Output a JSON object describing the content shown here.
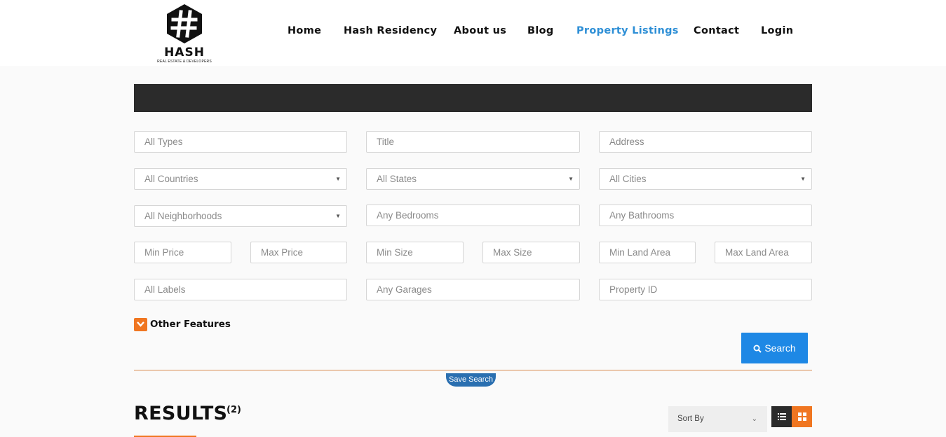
{
  "logo": {
    "word": "HASH",
    "tagline": "REAL ESTATE & DEVELOPERS",
    "icon": "hash-hexagon-logo"
  },
  "nav": {
    "items": [
      {
        "label": "Home"
      },
      {
        "label": "Hash Residency"
      },
      {
        "label": "About us"
      },
      {
        "label": "Blog"
      },
      {
        "label": "Property Listings",
        "active": true
      },
      {
        "label": "Contact"
      },
      {
        "label": "Login"
      }
    ]
  },
  "search_form": {
    "type": {
      "placeholder": "All Types"
    },
    "title": {
      "placeholder": "Title"
    },
    "address": {
      "placeholder": "Address"
    },
    "country": {
      "value": "All Countries"
    },
    "state": {
      "value": "All States"
    },
    "city": {
      "value": "All Cities"
    },
    "neighborhood": {
      "value": "All Neighborhoods"
    },
    "bedrooms": {
      "placeholder": "Any Bedrooms"
    },
    "bathrooms": {
      "placeholder": "Any Bathrooms"
    },
    "min_price": {
      "placeholder": "Min Price"
    },
    "max_price": {
      "placeholder": "Max Price"
    },
    "min_size": {
      "placeholder": "Min Size"
    },
    "max_size": {
      "placeholder": "Max Size"
    },
    "min_land_area": {
      "placeholder": "Min Land Area"
    },
    "max_land_area": {
      "placeholder": "Max Land Area"
    },
    "labels": {
      "placeholder": "All Labels"
    },
    "garages": {
      "placeholder": "Any Garages"
    },
    "property_id": {
      "placeholder": "Property ID"
    },
    "other_features_label": "Other Features",
    "search_label": "Search",
    "save_search_label": "Save Search"
  },
  "results": {
    "heading": "RESULTS",
    "count": "(2)",
    "sort_label": "Sort By"
  },
  "colors": {
    "accent_orange": "#f07621",
    "active_nav_blue": "#2e8fd6",
    "search_button_blue": "#1e88e5",
    "dark_bar": "#2b2b2b"
  }
}
